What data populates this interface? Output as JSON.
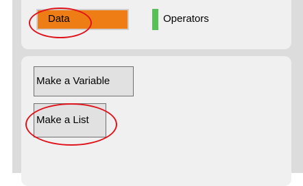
{
  "categories": [
    {
      "label": "Data",
      "color": "#ee7d16",
      "selected": true
    },
    {
      "label": "Operators",
      "color": "#59c059",
      "selected": false
    }
  ],
  "palette": {
    "make_variable_label": "Make a Variable",
    "make_list_label": "Make a List"
  },
  "annotation_color": "#e0131a"
}
